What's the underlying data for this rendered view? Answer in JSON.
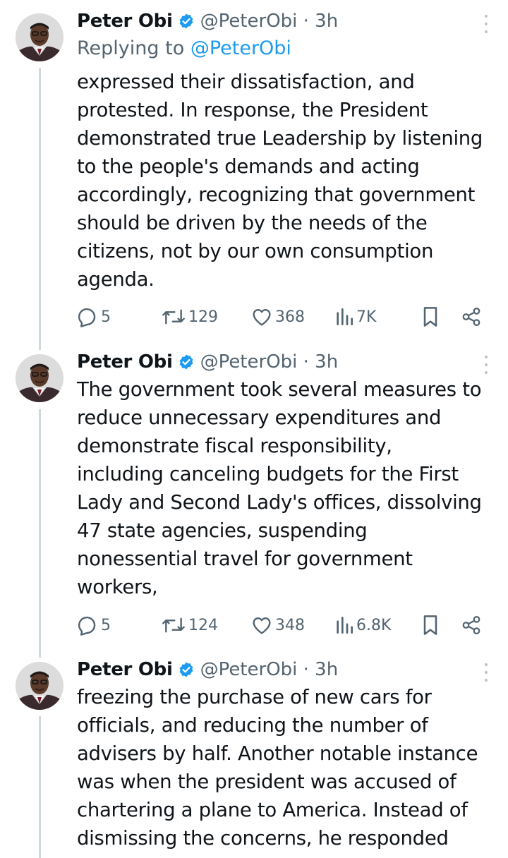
{
  "tweets": [
    {
      "author": "Peter Obi",
      "handle": "@PeterObi · 3h",
      "replying_prefix": "Replying to",
      "replying_to": "@PeterObi",
      "lines": [
        "expressed their dissatisfaction, and",
        "protested. In response, the President",
        "demonstrated true Leadership by listening",
        "to the people's demands and acting",
        "accordingly, recognizing that government",
        "should be driven by the needs of the",
        "citizens, not by our own consumption",
        "agenda."
      ],
      "replies": "5",
      "retweets": "129",
      "likes": "368",
      "views": "7K"
    },
    {
      "author": "Peter Obi",
      "handle": "@PeterObi · 3h",
      "lines": [
        "The government took several measures to",
        "reduce unnecessary expenditures and",
        "demonstrate fiscal responsibility,",
        "including canceling budgets for the First",
        "Lady and Second Lady's offices, dissolving",
        "47 state agencies, suspending",
        "nonessential travel for government",
        "workers,"
      ],
      "replies": "5",
      "retweets": "124",
      "likes": "348",
      "views": "6.8K"
    },
    {
      "author": "Peter Obi",
      "handle": "@PeterObi · 3h",
      "lines": [
        "freezing the purchase of new cars for",
        "officials, and reducing the number of",
        "advisers by half. Another notable instance",
        "was when the president was accused of",
        "chartering a plane to America. Instead of",
        "dismissing the concerns, he responded"
      ]
    }
  ],
  "icons": {
    "verified": "verified-badge-icon",
    "reply": "reply-icon",
    "retweet": "retweet-icon",
    "like": "heart-icon",
    "views": "views-icon",
    "bookmark": "bookmark-icon",
    "share": "share-icon",
    "more": "more-options-icon"
  },
  "colors": {
    "text": "#0f1419",
    "secondary": "#536471",
    "link": "#1d9bf0",
    "verified": "#1d9bf0",
    "thread_line": "#cfd9de"
  }
}
